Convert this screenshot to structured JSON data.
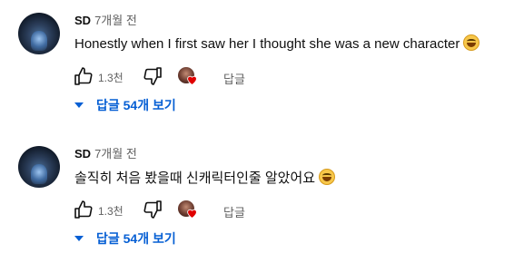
{
  "comments": [
    {
      "author": "SD",
      "time": "7개월 전",
      "text": "Honestly when I first saw her I thought she was a new character",
      "emoji": "grinning-squinting-face",
      "likes": "1.3천",
      "reply_label": "답글",
      "replies_label": "답글 54개 보기"
    },
    {
      "author": "SD",
      "time": "7개월 전",
      "text": "솔직히 처음 봤을때 신캐릭터인줄 알았어요",
      "emoji": "grinning-squinting-face",
      "likes": "1.3천",
      "reply_label": "답글",
      "replies_label": "답글 54개 보기"
    }
  ],
  "colors": {
    "link": "#065fd4",
    "secondary_text": "#606060",
    "heart": "#e00000"
  }
}
